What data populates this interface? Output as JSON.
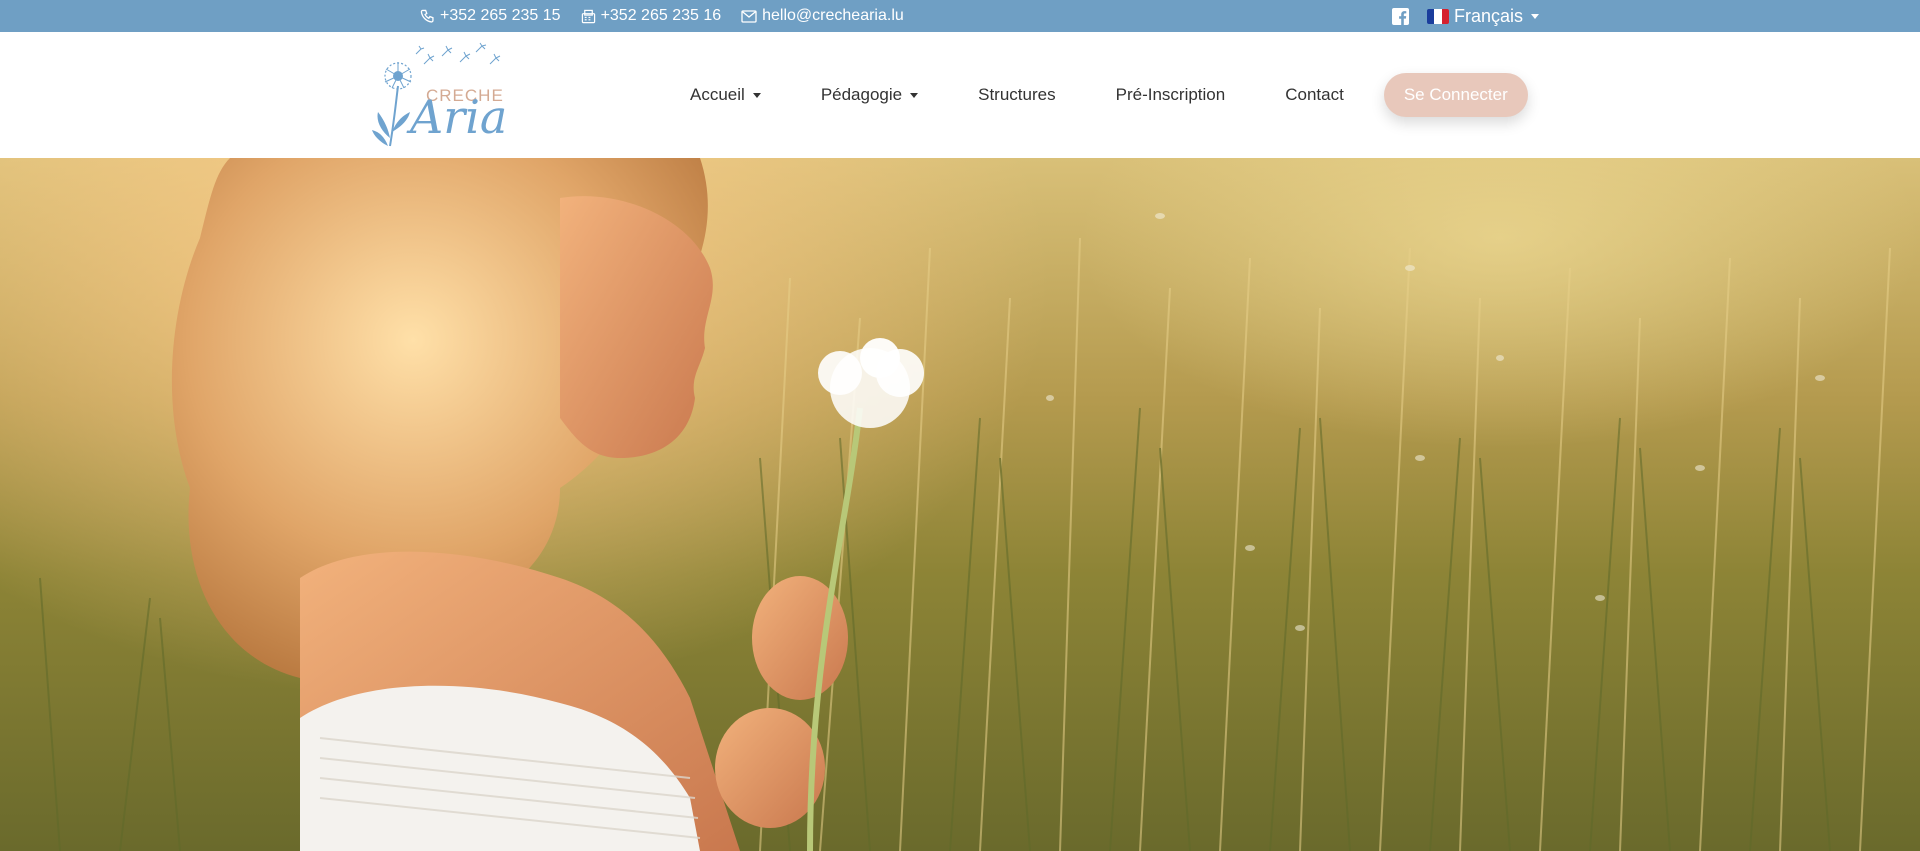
{
  "topbar": {
    "phone": "+352 265 235 15",
    "fax": "+352 265 235 16",
    "email": "hello@crechearia.lu",
    "language": "Français",
    "icons": [
      "phone-icon",
      "fax-icon",
      "envelope-icon",
      "facebook-icon",
      "flag-fr-icon"
    ],
    "background_color": "#6f9fc4"
  },
  "brand": {
    "line1": "CRECHE",
    "line2": "Aria"
  },
  "nav": {
    "items": [
      {
        "label": "Accueil",
        "dropdown": true
      },
      {
        "label": "Pédagogie",
        "dropdown": true
      },
      {
        "label": "Structures",
        "dropdown": false
      },
      {
        "label": "Pré-Inscription",
        "dropdown": false
      },
      {
        "label": "Contact",
        "dropdown": false
      }
    ],
    "login_label": "Se Connecter",
    "login_color": "#e8c8bb"
  },
  "hero": {
    "image": "girl-with-dandelion-in-wheat-field"
  }
}
